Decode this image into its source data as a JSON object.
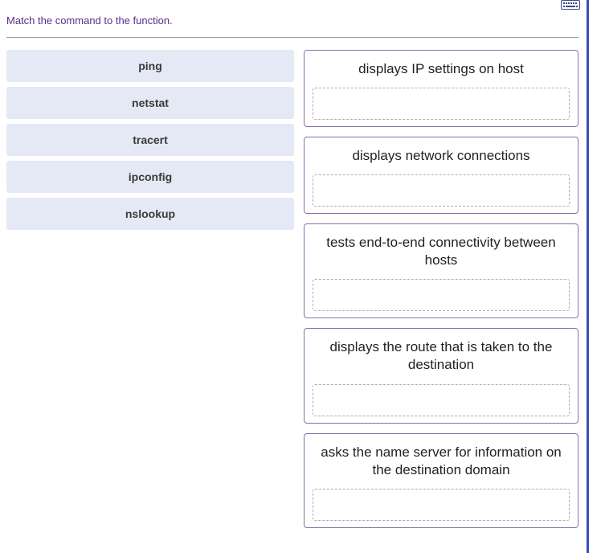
{
  "instruction": "Match the command to the function.",
  "commands": [
    {
      "label": "ping"
    },
    {
      "label": "netstat"
    },
    {
      "label": "tracert"
    },
    {
      "label": "ipconfig"
    },
    {
      "label": "nslookup"
    }
  ],
  "functions": [
    {
      "description": "displays IP settings on host"
    },
    {
      "description": "displays network connections"
    },
    {
      "description": "tests end-to-end connectivity between hosts"
    },
    {
      "description": "displays the route that is taken to the destination"
    },
    {
      "description": "asks the name server for information on the destination domain"
    }
  ]
}
